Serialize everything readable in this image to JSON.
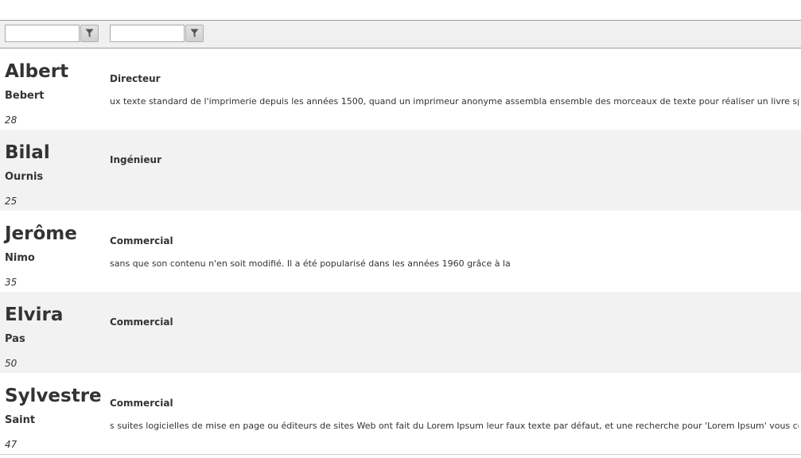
{
  "filters": {
    "filter_1": {
      "value": "",
      "placeholder": ""
    },
    "filter_2": {
      "value": "",
      "placeholder": ""
    },
    "filter_icon": "funnel-icon"
  },
  "rows": [
    {
      "first_name": "Albert",
      "last_name": "Bebert",
      "age": "28",
      "job": "Directeur",
      "description": "ux texte standard de l'imprimerie depuis les années 1500, quand un imprimeur anonyme assembla ensemble des morceaux de texte pour réaliser un livre spécimen"
    },
    {
      "first_name": "Bilal",
      "last_name": "Ournis",
      "age": "25",
      "job": "Ingénieur",
      "description": ""
    },
    {
      "first_name": "Jerôme",
      "last_name": "Nimo",
      "age": "35",
      "job": "Commercial",
      "description": "sans que son contenu n'en soit modifié. Il a été popularisé dans les années 1960 grâce à la"
    },
    {
      "first_name": "Elvira",
      "last_name": "Pas",
      "age": "50",
      "job": "Commercial",
      "description": ""
    },
    {
      "first_name": "Sylvestre",
      "last_name": "Saint",
      "age": "47",
      "job": "Commercial",
      "description": "s suites logicielles de mise en page ou éditeurs de sites Web ont fait du Lorem Ipsum leur faux texte par défaut, et une recherche pour 'Lorem Ipsum' vous cond"
    }
  ],
  "colors": {
    "row_alt": "#f2f2f2",
    "filter_bar": "#f0f0f0",
    "text": "#333333"
  }
}
